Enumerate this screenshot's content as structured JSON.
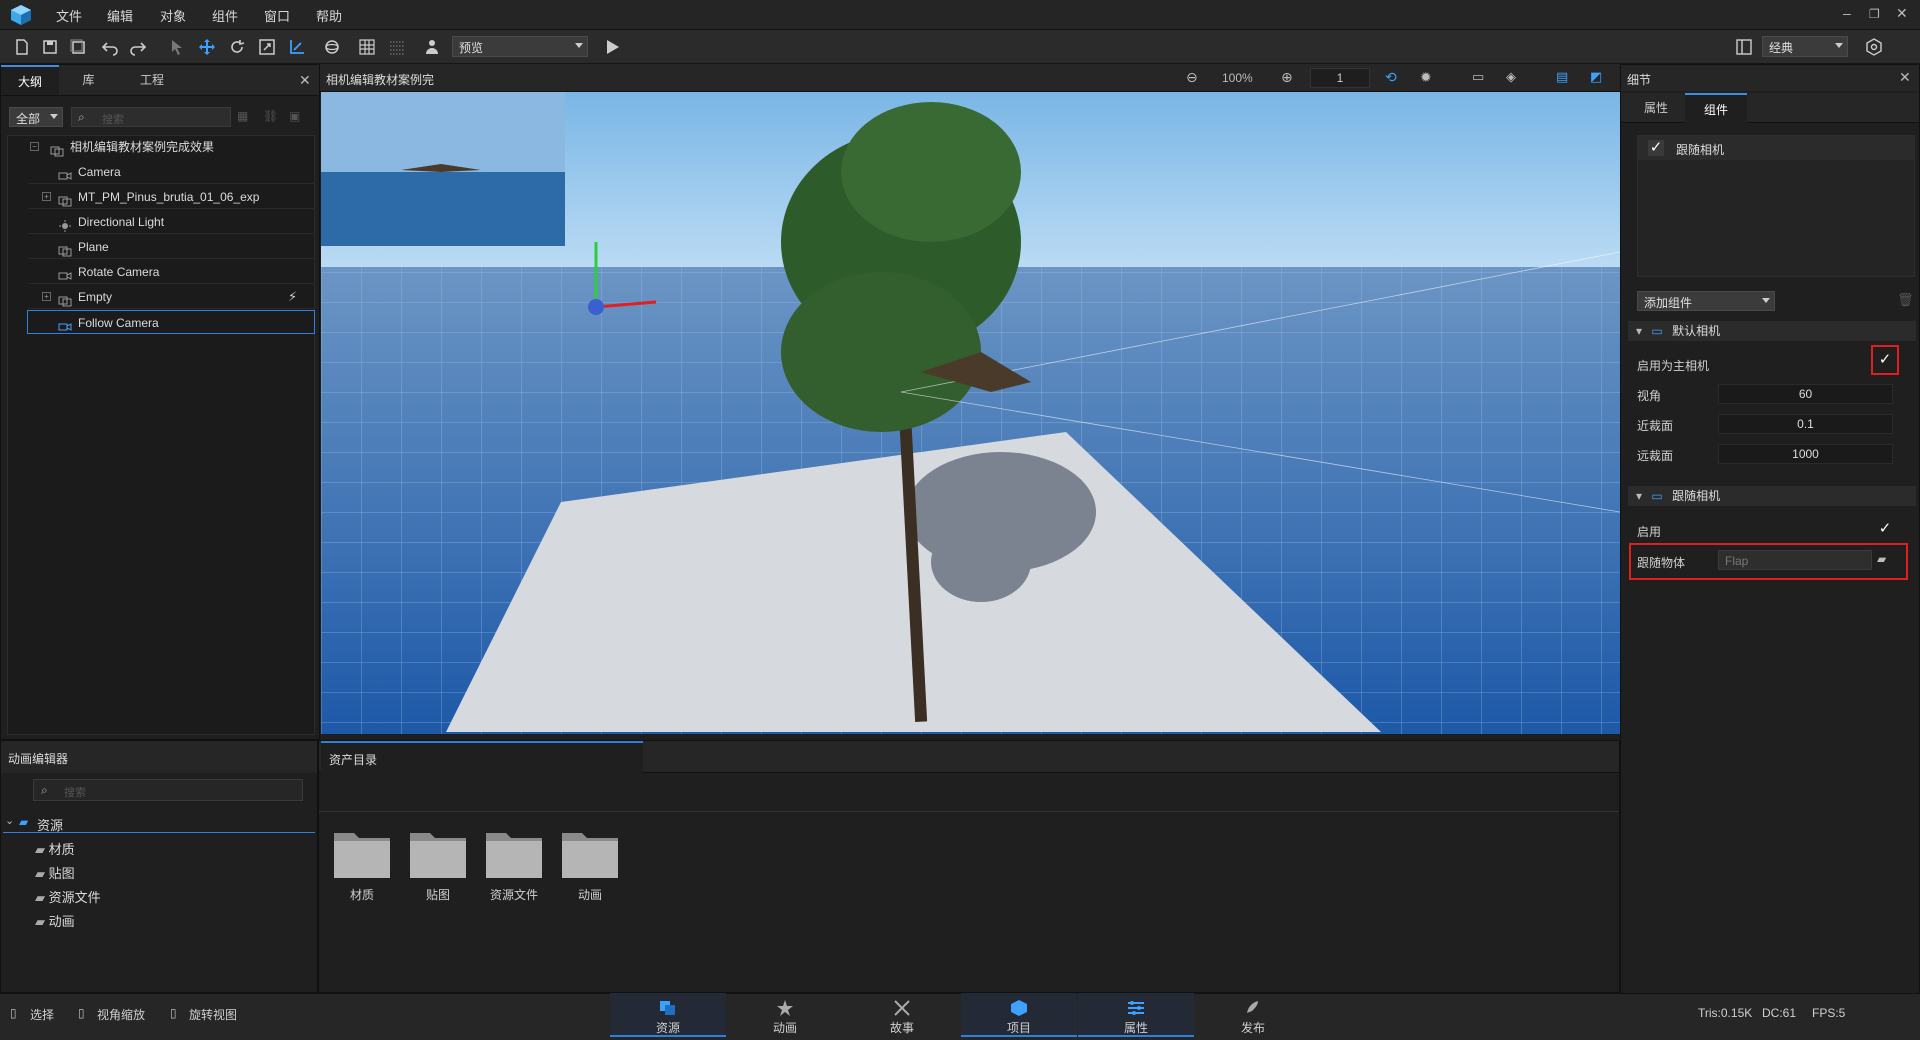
{
  "menu": {
    "items": [
      "文件",
      "编辑",
      "对象",
      "组件",
      "窗口",
      "帮助"
    ]
  },
  "toolbar": {
    "preview_mode": "预览",
    "layout_mode": "经典"
  },
  "outline": {
    "tabs": [
      "大纲",
      "库",
      "工程"
    ],
    "filter": "全部",
    "search_placeholder": "搜索",
    "root": "相机编辑教材案例完成效果",
    "items": [
      "Camera",
      "MT_PM_Pinus_brutia_01_06_exp",
      "Directional Light",
      "Plane",
      "Rotate Camera",
      "Empty",
      "Follow Camera"
    ]
  },
  "viewport": {
    "title": "相机编辑教材案例完",
    "zoom": "100%",
    "frame": "1"
  },
  "details": {
    "title": "细节",
    "tabs": [
      "属性",
      "组件"
    ],
    "component_list": [
      "跟随相机"
    ],
    "add_component": "添加组件",
    "default_camera": {
      "header": "默认相机",
      "main_camera_label": "启用为主相机",
      "main_camera_checked": true,
      "fov_label": "视角",
      "fov": "60",
      "near_label": "近裁面",
      "near": "0.1",
      "far_label": "远裁面",
      "far": "1000"
    },
    "follow_camera": {
      "header": "跟随相机",
      "enable_label": "启用",
      "enable_checked": true,
      "target_label": "跟随物体",
      "target_value": "Flap"
    }
  },
  "anim_editor": {
    "title": "动画编辑器",
    "search_placeholder": "搜索",
    "root": "资源",
    "children": [
      "材质",
      "贴图",
      "资源文件",
      "动画"
    ]
  },
  "assets": {
    "title": "资产目录",
    "folders": [
      "材质",
      "贴图",
      "资源文件",
      "动画"
    ]
  },
  "status": {
    "hints": [
      "选择",
      "视角缩放",
      "旋转视图"
    ],
    "nav": [
      "资源",
      "动画",
      "故事",
      "项目",
      "属性",
      "发布"
    ],
    "tris": "Tris:0.15K",
    "dc": "DC:61",
    "fps": "FPS:5"
  },
  "colors": {
    "accent": "#2d7fe0",
    "highlight": "#e02020",
    "panel": "#1f1f1f"
  }
}
